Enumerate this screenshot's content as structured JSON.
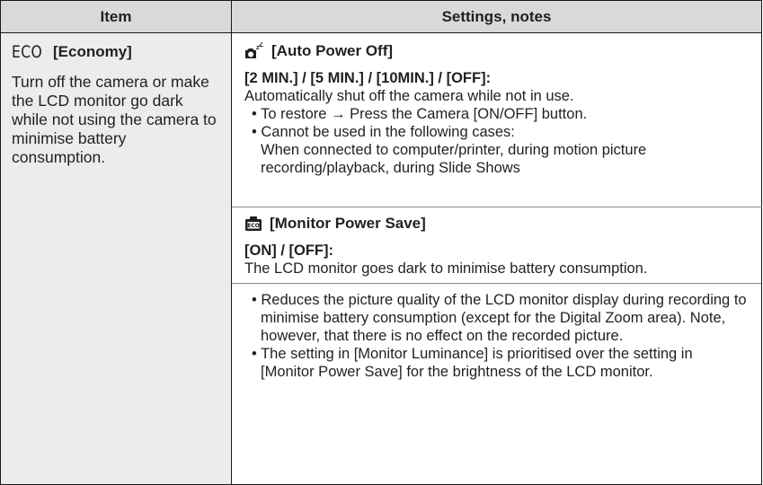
{
  "table": {
    "header": {
      "item": "Item",
      "settings": "Settings, notes"
    },
    "economy": {
      "icon_text": "ECO",
      "label": "[Economy]",
      "description": "Turn off the camera or make the LCD monitor go dark while not using the camera to minimise battery consumption."
    },
    "auto_power_off": {
      "icon": "sleep-camera-icon",
      "label": "[Auto Power Off]",
      "options": "[2 MIN.] / [5 MIN.] / [10MIN.] / [OFF]:",
      "description": "Automatically shut off the camera while not in use.",
      "bullets": [
        "To restore → Press the Camera [ON/OFF] button.",
        "Cannot be used in the following cases:"
      ],
      "cases": "When connected to computer/printer, during motion picture recording/playback, during Slide Shows"
    },
    "monitor_power_save": {
      "icon": "eco-monitor-icon",
      "label": "[Monitor Power Save]",
      "options": "[ON] / [OFF]:",
      "description": "The LCD monitor goes dark to minimise battery consumption.",
      "bullets": [
        "Reduces the picture quality of the LCD monitor display during recording to minimise battery consumption (except for the Digital Zoom area). Note, however, that there is no effect on the recorded picture.",
        "The setting in [Monitor Luminance] is prioritised over the setting in [Monitor Power Save] for the brightness of the LCD monitor."
      ]
    }
  }
}
